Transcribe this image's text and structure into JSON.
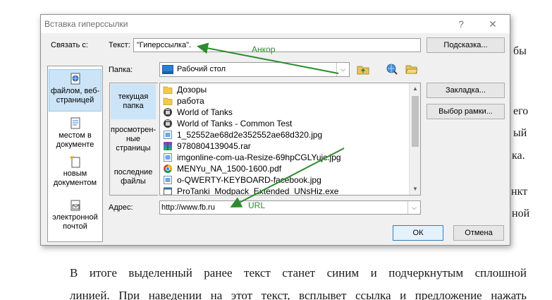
{
  "background": {
    "right_fragments": [
      "бы",
      "его",
      "ый",
      "ка.",
      "нкт",
      "ной"
    ],
    "paragraph_lines": [
      "В итоге выделенный ранее текст станет синим и подчеркнутым сплошной",
      "линией. При наведении на этот текст, всплывет ссылка и предложение нажать"
    ]
  },
  "dialog": {
    "title": "Вставка гиперссылки",
    "help_glyph": "?",
    "close_glyph": "✕",
    "link_to_label": "Связать с:",
    "link_to_items": [
      {
        "label": "файлом, веб-страницей",
        "icon": "web-page-icon"
      },
      {
        "label": "местом в документе",
        "icon": "document-place-icon"
      },
      {
        "label": "новым документом",
        "icon": "new-document-icon"
      },
      {
        "label": "электронной почтой",
        "icon": "email-icon"
      }
    ],
    "text_label": "Текст:",
    "text_value": "\"Гиперссылка\".",
    "tooltip_button": "Подсказка...",
    "folder_label": "Папка:",
    "folder_value": "Рабочий стол",
    "tabs": [
      {
        "label": "текущая папка"
      },
      {
        "label": "просмотрен-ные страницы"
      },
      {
        "label": "последние файлы"
      }
    ],
    "files": [
      {
        "name": "Дозоры",
        "icon": "folder-icon"
      },
      {
        "name": "работа",
        "icon": "folder-icon"
      },
      {
        "name": "World of Tanks",
        "icon": "tank-app-icon"
      },
      {
        "name": "World of Tanks - Common Test",
        "icon": "tank-app-icon"
      },
      {
        "name": "1_52552ae68d2e352552ae68d320.jpg",
        "icon": "image-file-icon"
      },
      {
        "name": "9780804139045.rar",
        "icon": "archive-icon"
      },
      {
        "name": "imgonline-com-ua-Resize-69hpCGLYujc.jpg",
        "icon": "image-file-icon"
      },
      {
        "name": "MENYu_NA_1500-1600.pdf",
        "icon": "pdf-chrome-icon"
      },
      {
        "name": "o-QWERTY-KEYBOARD-facebook.jpg",
        "icon": "image-file-icon"
      },
      {
        "name": "ProTanki_Modpack_Extended_UNsHiz.exe",
        "icon": "exe-file-icon"
      }
    ],
    "bookmark_button": "Закладка...",
    "frame_button": "Выбор рамки...",
    "address_label": "Адрес:",
    "address_value": "http://www.fb.ru",
    "ok_button": "ОК",
    "cancel_button": "Отмена"
  },
  "annotations": {
    "anchor_label": "Анкор",
    "url_label": "URL",
    "color": "#2e8b2e"
  }
}
